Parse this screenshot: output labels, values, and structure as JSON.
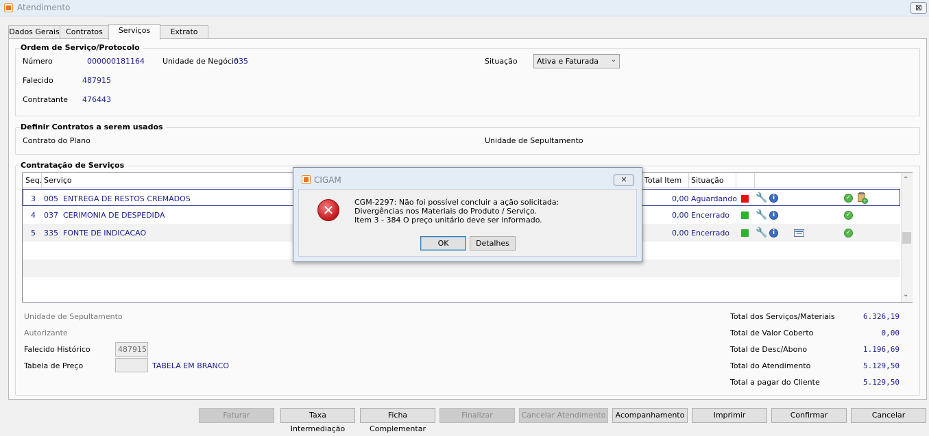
{
  "window": {
    "title": "Atendimento",
    "close_label": "⊠"
  },
  "tabs": [
    {
      "label": "Dados Gerais"
    },
    {
      "label": "Contratos"
    },
    {
      "label": "Serviços"
    },
    {
      "label": "Extrato"
    }
  ],
  "ordem": {
    "title": "Ordem de Serviço/Protocolo",
    "numero_label": "Número",
    "numero_value": "000000181164",
    "unidade_label": "Unidade de Negócio",
    "unidade_value": "035",
    "situacao_label": "Situação",
    "situacao_value": "Ativa e Faturada",
    "falecido_label": "Falecido",
    "falecido_value": "487915",
    "contratante_label": "Contratante",
    "contratante_value": "476443"
  },
  "contratos": {
    "title": "Definir Contratos a serem usados",
    "plano_label": "Contrato do Plano",
    "sepultamento_label": "Unidade de Sepultamento"
  },
  "servicos": {
    "title": "Contratação de Serviços",
    "headers": {
      "seq": "Seq.",
      "servico": "Serviço",
      "valor": "r Total Item",
      "situacao": "Situação"
    },
    "rows": [
      {
        "seq": "3",
        "code": "005",
        "name": "ENTREGA DE RESTOS CREMADOS",
        "valor": "0,00",
        "situacao": "Aguardando",
        "status_color": "#e81010"
      },
      {
        "seq": "4",
        "code": "037",
        "name": "CERIMONIA DE DESPEDIDA",
        "valor": "0,00",
        "situacao": "Encerrado",
        "status_color": "#2db32d"
      },
      {
        "seq": "5",
        "code": "335",
        "name": "FONTE DE INDICACAO",
        "valor": "0,00",
        "situacao": "Encerrado",
        "status_color": "#2db32d"
      }
    ]
  },
  "lower": {
    "sepultamento_label": "Unidade de Sepultamento",
    "autorizante_label": "Autorizante",
    "falecido_hist_label": "Falecido Histórico",
    "falecido_hist_value": "487915",
    "tabela_label": "Tabela de Preço",
    "tabela_value": "",
    "tabela_text": "TABELA EM BRANCO"
  },
  "totals": [
    {
      "label": "Total dos Serviços/Materiais",
      "value": "6.326,19"
    },
    {
      "label": "Total de Valor Coberto",
      "value": "0,00"
    },
    {
      "label": "Total de Desc/Abono",
      "value": "1.196,69"
    },
    {
      "label": "Total do Atendimento",
      "value": "5.129,50"
    },
    {
      "label": "Total a pagar do Cliente",
      "value": "5.129,50"
    }
  ],
  "buttons": {
    "faturar": "Faturar",
    "taxa": "Taxa Intermediação",
    "ficha": "Ficha Complementar",
    "finalizar": "Finalizar",
    "cancelar_at": "Cancelar Atendimento",
    "acompanhamento": "Acompanhamento",
    "imprimir": "Imprimir",
    "confirmar": "Confirmar",
    "cancelar": "Cancelar"
  },
  "dialog": {
    "title": "CIGAM",
    "close_label": "✕",
    "line1": "CGM-2297: Não foi possível concluir a ação solicitada:",
    "line2": "Divergências nos Materiais do Produto / Serviço.",
    "line3": "Item 3 - 384 O preço unitário deve ser informado.",
    "ok": "OK",
    "details": "Detalhes"
  }
}
